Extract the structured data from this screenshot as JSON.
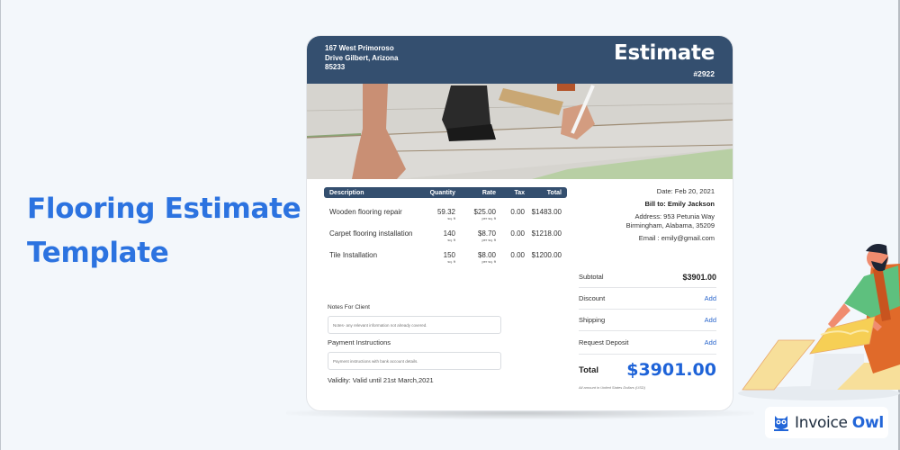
{
  "page": {
    "title_line1": "Flooring Estimate",
    "title_line2": "Template",
    "accent_color": "#2c73e0"
  },
  "estimate": {
    "company_address": [
      "167 West Primoroso",
      "Drive Gilbert, Arizona",
      "85233"
    ],
    "doc_title": "Estimate",
    "doc_number": "#2922",
    "header_color": "#344f6f",
    "table": {
      "headers": [
        "Description",
        "Quantity",
        "Rate",
        "Tax",
        "Total"
      ],
      "rows": [
        {
          "description": "Wooden flooring repair",
          "quantity": "59.32",
          "quantity_unit": "sq. ft",
          "rate": "$25.00",
          "rate_unit": "per sq. ft",
          "tax": "0.00",
          "total": "$1483.00"
        },
        {
          "description": "Carpet flooring installation",
          "quantity": "140",
          "quantity_unit": "sq. ft",
          "rate": "$8.70",
          "rate_unit": "per sq. ft",
          "tax": "0.00",
          "total": "$1218.00"
        },
        {
          "description": "Tile Installation",
          "quantity": "150",
          "quantity_unit": "sq. ft",
          "rate": "$8.00",
          "rate_unit": "per sq. ft",
          "tax": "0.00",
          "total": "$1200.00"
        }
      ]
    },
    "bill": {
      "date": "Date: Feb 20, 2021",
      "bill_to": "Bill to: Emily Jackson",
      "address_line1": "Address: 953 Petunia Way",
      "address_line2": "Birmingham,  Alabama, 35209",
      "email": "Email : emily@gmail.com"
    },
    "summary": {
      "subtotal_label": "Subtotal",
      "subtotal_value": "$3901.00",
      "discount_label": "Discount",
      "shipping_label": "Shipping",
      "deposit_label": "Request Deposit",
      "add_label": "Add",
      "total_label": "Total",
      "total_value": "$3901.00",
      "footnote": "All amount in United States Dollars (USD)"
    },
    "notes": {
      "notes_label": "Notes For Client",
      "notes_placeholder": "Notes- any relevant information not already covered.",
      "payment_label": "Payment Instructions",
      "payment_placeholder": "Payment instructions with bank account details.",
      "validity": "Validity: Valid until 21st March,2021"
    }
  },
  "brand": {
    "name_part1": "Invoice",
    "name_part2": "Owl",
    "icon": "owl-icon"
  }
}
